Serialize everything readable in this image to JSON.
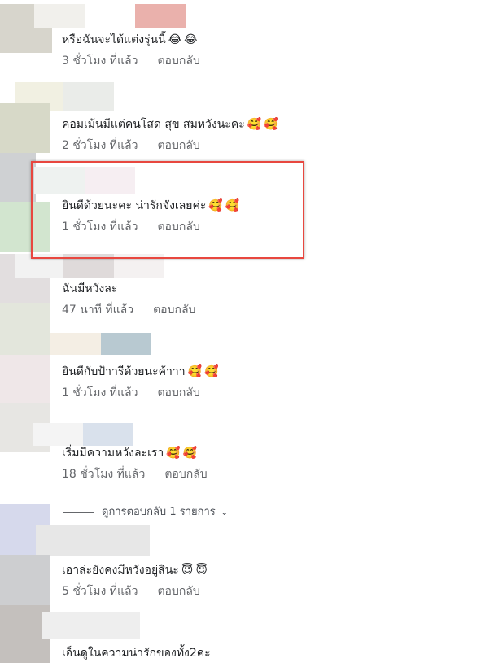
{
  "colors": {
    "text": "#1c1e21",
    "meta": "#65676b",
    "highlight_border": "#e8473f"
  },
  "comments": [
    {
      "text": "หรือฉันจะได้แต่งรุ่นนี้",
      "emojis": [
        "laughing-face",
        "laughing-face"
      ],
      "time": "3 ชั่วโมง ที่แล้ว",
      "reply": "ตอบกลับ"
    },
    {
      "text": "คอมเม้นมีแต่คนโสด สุข สมหวังนะคะ",
      "emojis": [
        "smiling-face-with-hearts",
        "smiling-face-with-hearts"
      ],
      "time": "2 ชั่วโมง ที่แล้ว",
      "reply": "ตอบกลับ"
    },
    {
      "text": "ยินดีด้วยนะคะ น่ารักจังเลยค่ะ",
      "emojis": [
        "smiling-face-with-hearts",
        "smiling-face-with-hearts"
      ],
      "time": "1 ชั่วโมง ที่แล้ว",
      "reply": "ตอบกลับ"
    },
    {
      "text": "ฉันมีหวังละ",
      "emojis": [],
      "time": "47 นาที ที่แล้ว",
      "reply": "ตอบกลับ"
    },
    {
      "text": "ยินดีกับป้าารีด้วยนะค้าาา",
      "emojis": [
        "smiling-face-with-hearts",
        "smiling-face-with-hearts"
      ],
      "time": "1 ชั่วโมง ที่แล้ว",
      "reply": "ตอบกลับ"
    },
    {
      "text": "เริ่มมีความหวังละเรา",
      "emojis": [
        "smiling-face-with-hearts",
        "smiling-face-with-hearts"
      ],
      "time": "18 ชั่วโมง ที่แล้ว",
      "reply": "ตอบกลับ"
    },
    {
      "text": "เอาล่ะยังคงมีหวังอยู่สินะ",
      "emojis": [
        "smiling-face-with-halo",
        "smiling-face-with-halo"
      ],
      "time": "5 ชั่วโมง ที่แล้ว",
      "reply": "ตอบกลับ"
    },
    {
      "text": "เอ็นดูในความน่ารักของทั้ง2คะ",
      "emojis": []
    }
  ],
  "view_replies": {
    "label": "ดูการตอบกลับ 1 รายการ",
    "icon": "chevron-down-icon"
  }
}
